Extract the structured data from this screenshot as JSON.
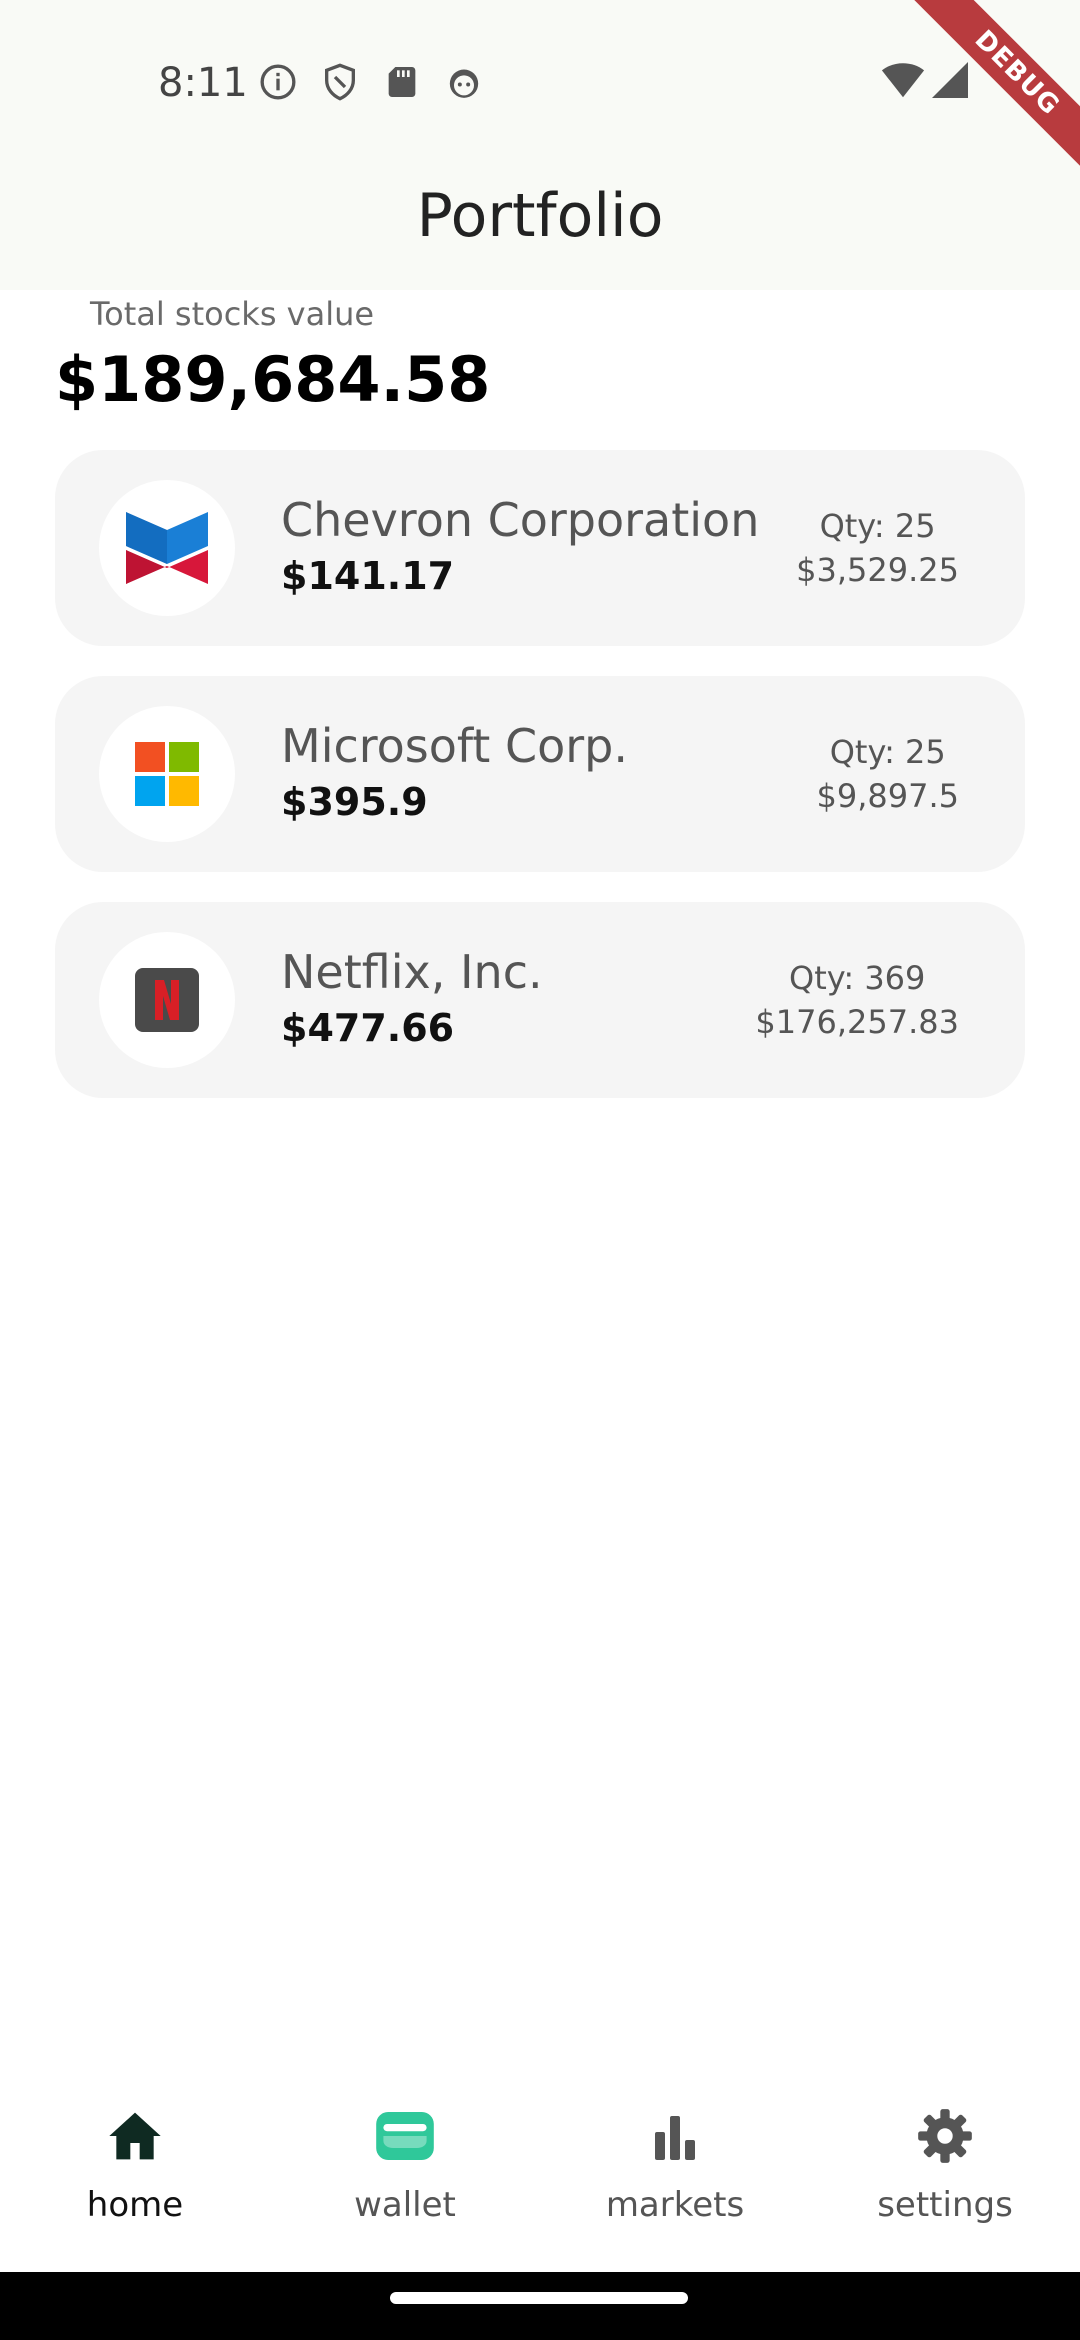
{
  "status_bar": {
    "time": "8:11",
    "icons_left": [
      "info-icon",
      "shield-icon",
      "sd-card-icon",
      "android-face-icon"
    ],
    "icons_right": [
      "wifi-icon",
      "cell-signal-icon"
    ]
  },
  "app_bar": {
    "title": "Portfolio",
    "debug_banner": "DEBUG"
  },
  "summary": {
    "label": "Total stocks value",
    "value": "$189,684.58"
  },
  "stocks": [
    {
      "name": "Chevron Corporation",
      "price": "$141.17",
      "qty": "Qty: 25",
      "value": "$3,529.25",
      "logo": "chevron-logo-icon"
    },
    {
      "name": "Microsoft Corp.",
      "price": "$395.9",
      "qty": "Qty: 25",
      "value": "$9,897.5",
      "logo": "microsoft-logo-icon"
    },
    {
      "name": "Netflix, Inc.",
      "price": "$477.66",
      "qty": "Qty: 369",
      "value": "$176,257.83",
      "logo": "netflix-logo-icon"
    }
  ],
  "bottom_nav": {
    "items": [
      {
        "label": "home",
        "icon": "home-icon",
        "active": true
      },
      {
        "label": "wallet",
        "icon": "wallet-icon",
        "active": false
      },
      {
        "label": "markets",
        "icon": "bar-chart-icon",
        "active": false
      },
      {
        "label": "settings",
        "icon": "gear-icon",
        "active": false
      }
    ]
  },
  "colors": {
    "app_bar_bg": "#f9faf6",
    "card_bg": "#f5f5f5",
    "wallet_accent": "#2fc89a",
    "debug_ribbon": "#b83b3e",
    "home_icon": "#0f2a22"
  }
}
